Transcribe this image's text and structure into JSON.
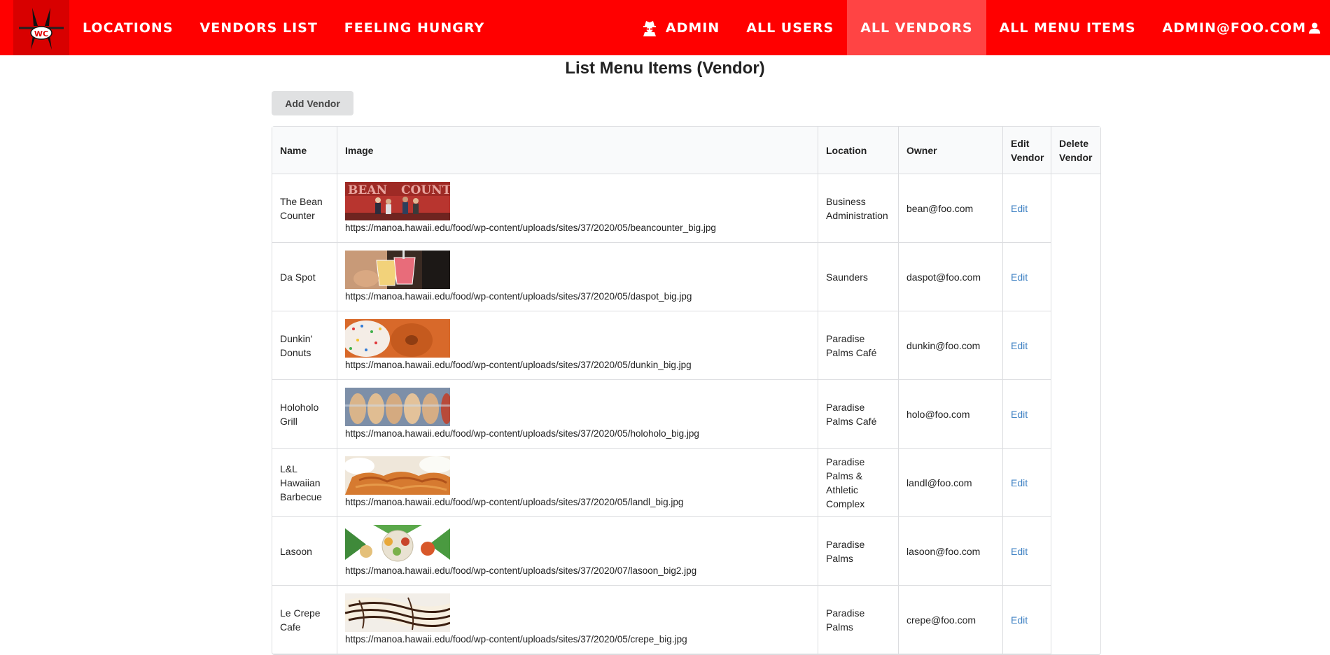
{
  "nav": {
    "logo_text": "WC",
    "left_items": [
      "Locations",
      "Vendors List",
      "Feeling Hungry"
    ],
    "admin_label": "Admin",
    "right_items": [
      "All Users",
      "All Vendors",
      "All Menu Items"
    ],
    "active_item": "All Vendors",
    "user_label": "admin@foo.com"
  },
  "page": {
    "title": "List Menu Items (Vendor)",
    "add_button": "Add Vendor"
  },
  "table": {
    "headers": [
      "Name",
      "Image",
      "Location",
      "Owner",
      "Edit Vendor",
      "Delete Vendor"
    ],
    "rows": [
      {
        "name": "The Bean Counter",
        "image_url": "https://manoa.hawaii.edu/food/wp-content/uploads/sites/37/2020/05/beancounter_big.jpg",
        "location": "Business Administration",
        "owner": "bean@foo.com",
        "edit": "Edit"
      },
      {
        "name": "Da Spot",
        "image_url": "https://manoa.hawaii.edu/food/wp-content/uploads/sites/37/2020/05/daspot_big.jpg",
        "location": "Saunders",
        "owner": "daspot@foo.com",
        "edit": "Edit"
      },
      {
        "name": "Dunkin' Donuts",
        "image_url": "https://manoa.hawaii.edu/food/wp-content/uploads/sites/37/2020/05/dunkin_big.jpg",
        "location": "Paradise Palms Café",
        "owner": "dunkin@foo.com",
        "edit": "Edit"
      },
      {
        "name": "Holoholo Grill",
        "image_url": "https://manoa.hawaii.edu/food/wp-content/uploads/sites/37/2020/05/holoholo_big.jpg",
        "location": "Paradise Palms Café",
        "owner": "holo@foo.com",
        "edit": "Edit"
      },
      {
        "name": "L&L Hawaiian Barbecue",
        "image_url": "https://manoa.hawaii.edu/food/wp-content/uploads/sites/37/2020/05/landl_big.jpg",
        "location": "Paradise Palms & Athletic Complex",
        "owner": "landl@foo.com",
        "edit": "Edit"
      },
      {
        "name": "Lasoon",
        "image_url": "https://manoa.hawaii.edu/food/wp-content/uploads/sites/37/2020/07/lasoon_big2.jpg",
        "location": "Paradise Palms",
        "owner": "lasoon@foo.com",
        "edit": "Edit"
      },
      {
        "name": "Le Crepe Cafe",
        "image_url": "https://manoa.hawaii.edu/food/wp-content/uploads/sites/37/2020/05/crepe_big.jpg",
        "location": "Paradise Palms",
        "owner": "crepe@foo.com",
        "edit": "Edit"
      }
    ]
  },
  "colors": {
    "navbar": "#ff0000",
    "navbar_active": "#ff4444",
    "link": "#4183c4"
  }
}
